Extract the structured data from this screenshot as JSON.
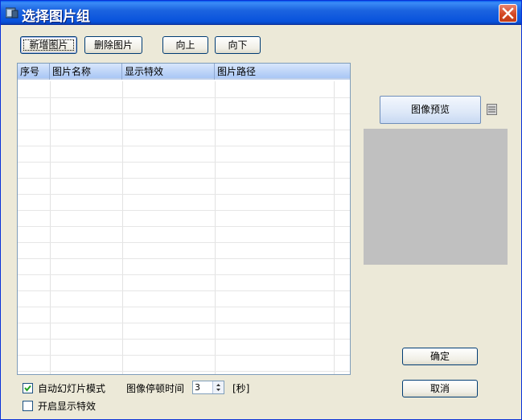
{
  "window": {
    "title": "选择图片组"
  },
  "toolbar": {
    "add_label": "新增图片",
    "delete_label": "删除图片",
    "up_label": "向上",
    "down_label": "向下"
  },
  "table": {
    "columns": [
      "序号",
      "图片名称",
      "显示特效",
      "图片路径"
    ],
    "rows": []
  },
  "preview": {
    "button_label": "图像预览"
  },
  "dialog_buttons": {
    "ok_label": "确定",
    "cancel_label": "取消"
  },
  "options": {
    "auto_slideshow_label": "自动幻灯片模式",
    "auto_slideshow_checked": true,
    "enable_effects_label": "开启显示特效",
    "enable_effects_checked": false,
    "pause_time_label": "图像停顿时间",
    "pause_time_value": "3",
    "pause_time_unit": "[秒]"
  },
  "colors": {
    "titlebar": "#0852dc",
    "window_bg": "#ece9d8",
    "preview_bg": "#c0c0c0"
  }
}
